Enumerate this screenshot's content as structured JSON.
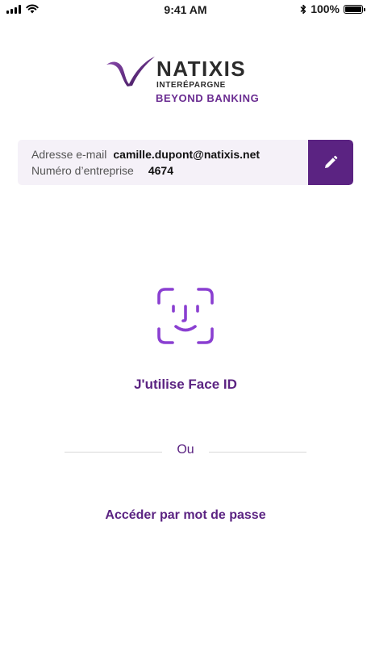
{
  "status_bar": {
    "time": "9:41 AM",
    "battery": "100%",
    "battery_level": 1.0
  },
  "brand": {
    "name": "NATIXIS",
    "subtitle": "INTERÉPARGNE",
    "tagline": "BEYOND BANKING"
  },
  "account": {
    "email_label": "Adresse e-mail",
    "email_value": "camille.dupont@natixis.net",
    "company_label": "Numéro d’entreprise",
    "company_value": "4674"
  },
  "icons": {
    "edit": "pencil-icon",
    "faceid": "face-id-icon",
    "wifi": "wifi-icon",
    "bluetooth": "bluetooth-icon",
    "battery": "battery-icon",
    "signal": "signal-icon"
  },
  "faceid": {
    "label": "J'utilise Face ID"
  },
  "divider": {
    "label": "Ou"
  },
  "password": {
    "label": "Accéder par mot de passe"
  },
  "colors": {
    "accent": "#5b2382",
    "faceid": "#8a3fd1",
    "card_bg": "#f5f1f8"
  }
}
